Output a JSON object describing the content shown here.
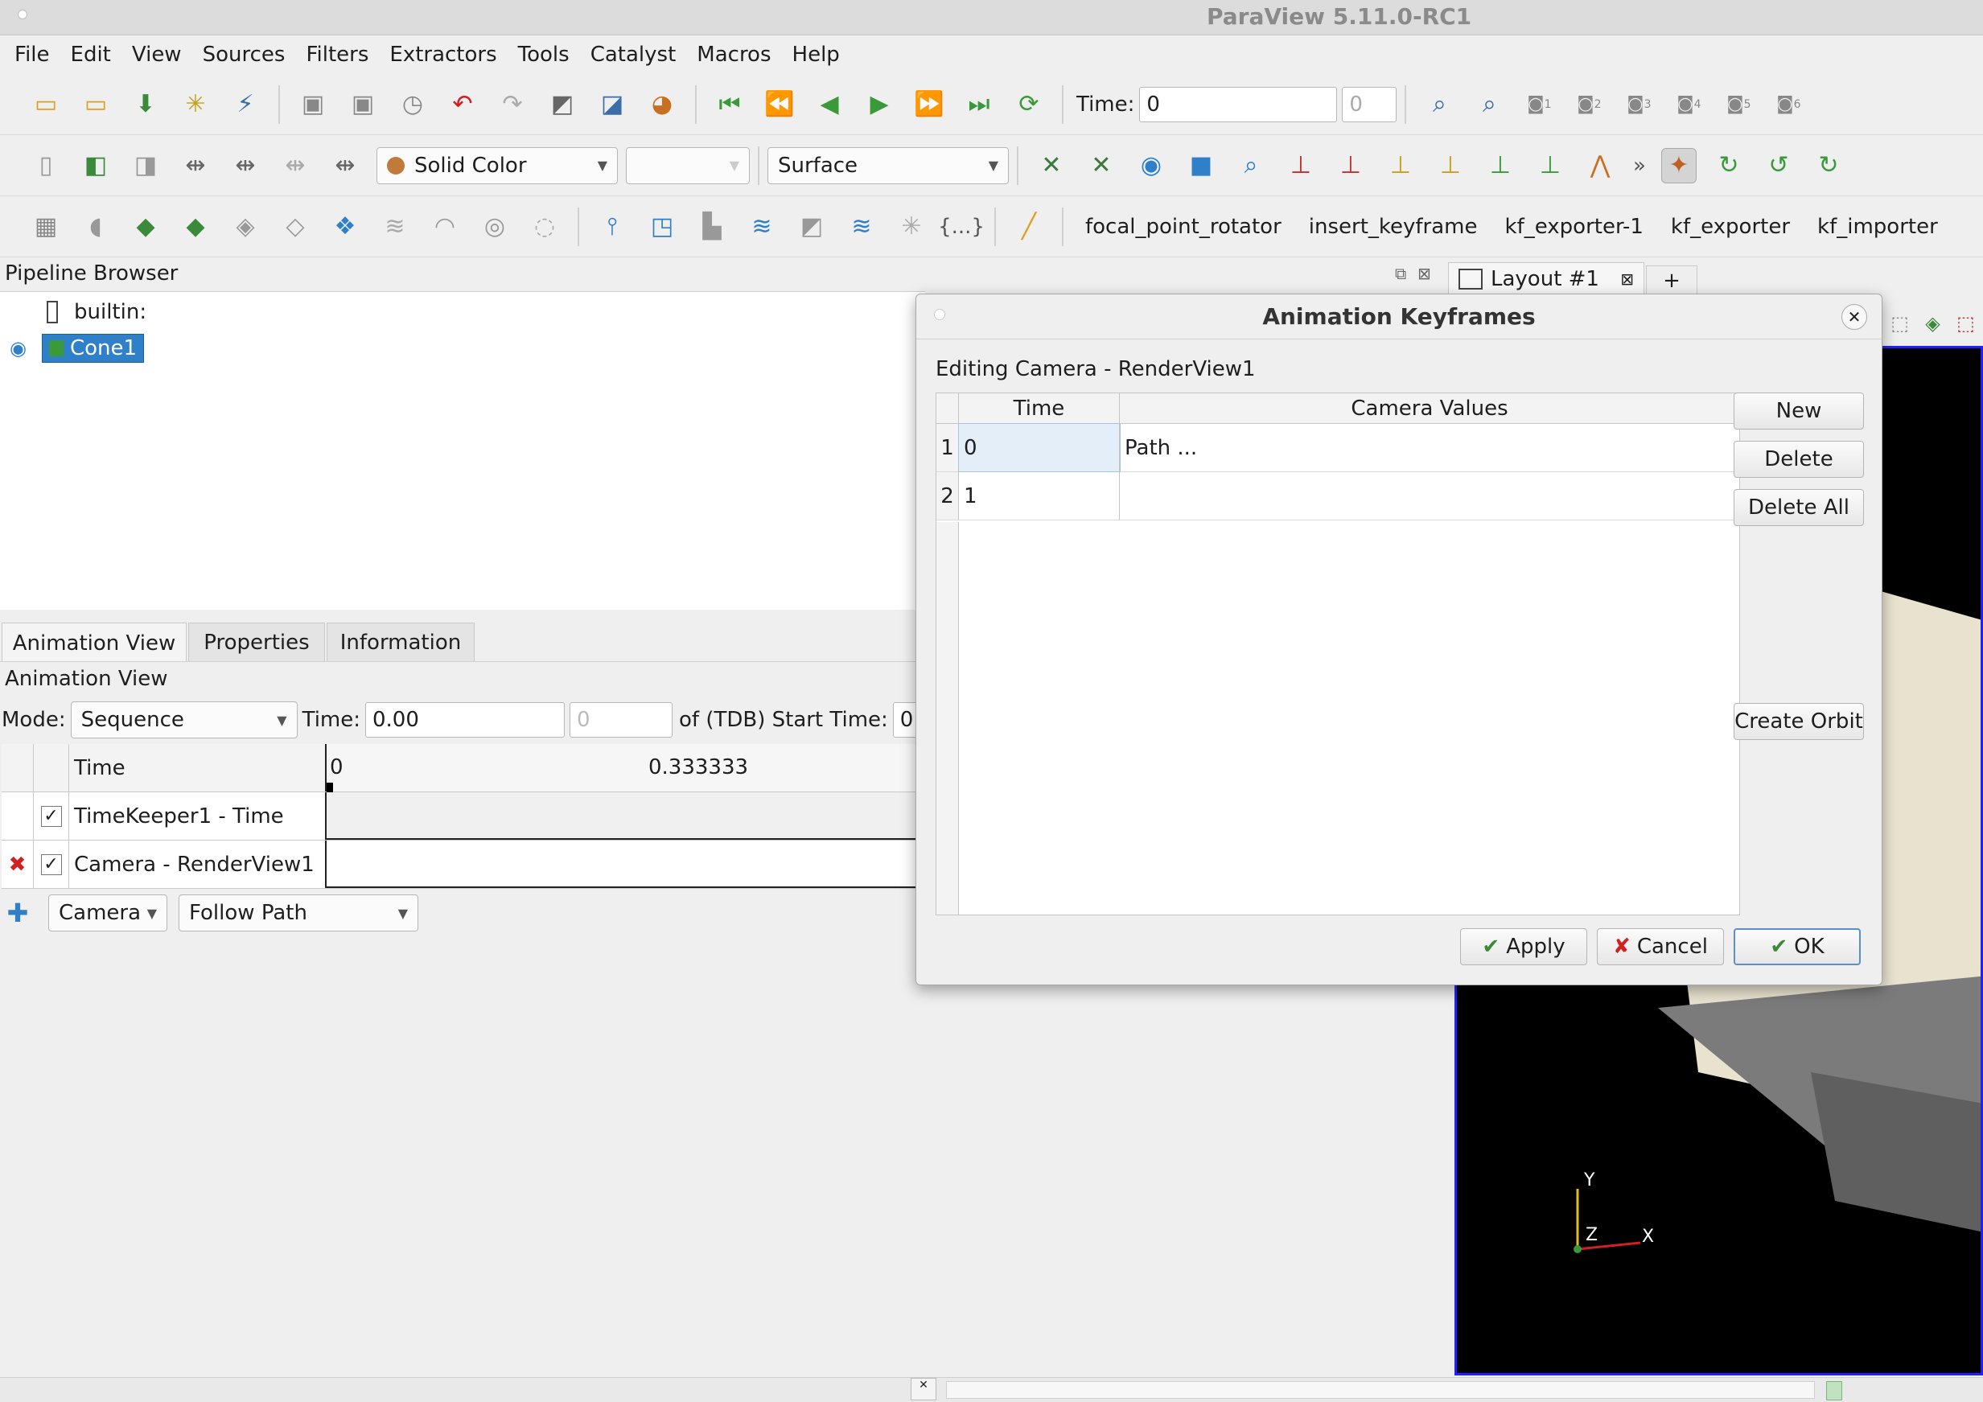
{
  "app": {
    "title": "ParaView 5.11.0-RC1"
  },
  "menu": [
    "File",
    "Edit",
    "View",
    "Sources",
    "Filters",
    "Extractors",
    "Tools",
    "Catalyst",
    "Macros",
    "Help"
  ],
  "toolbar1": {
    "time_label": "Time:",
    "time_value": "0",
    "time_index": "0",
    "camera_subscripts": [
      "1",
      "2",
      "3",
      "4",
      "5",
      "6"
    ]
  },
  "toolbar2": {
    "coloring": "Solid Color",
    "representation": "Surface",
    "more": "»"
  },
  "toolbar3": {
    "macros": [
      "focal_point_rotator",
      "insert_keyframe",
      "kf_exporter-1",
      "kf_exporter",
      "kf_importer"
    ],
    "braces": "{...}"
  },
  "pipeline": {
    "title": "Pipeline Browser",
    "builtin": "builtin:",
    "source": "Cone1"
  },
  "layout": {
    "tab": "Layout #1",
    "add": "+"
  },
  "tabs": [
    "Animation View",
    "Properties",
    "Information"
  ],
  "animation": {
    "title": "Animation View",
    "mode_label": "Mode:",
    "mode_value": "Sequence",
    "time_label": "Time:",
    "time_value": "0.00",
    "spin_value": "0",
    "of_label": "of (TDB) Start Time:",
    "start_value": "0",
    "header_time": "Time",
    "tick_start": "0",
    "tick_mid": "0.333333",
    "tracks": [
      {
        "label": "TimeKeeper1 - Time",
        "checked": "✓"
      },
      {
        "label": "Camera - RenderView1",
        "checked": "✓"
      }
    ],
    "add_source": "Camera",
    "add_mode": "Follow Path"
  },
  "dialog": {
    "title": "Animation Keyframes",
    "subtitle": "Editing Camera - RenderView1",
    "columns": [
      "Time",
      "Camera Values"
    ],
    "rows": [
      {
        "n": "1",
        "time": "0",
        "value": "Path ..."
      },
      {
        "n": "2",
        "time": "1",
        "value": ""
      }
    ],
    "buttons": {
      "new": "New",
      "delete": "Delete",
      "delete_all": "Delete All",
      "create_orbit": "Create Orbit"
    },
    "footer": {
      "apply": "Apply",
      "cancel": "Cancel",
      "ok": "OK"
    }
  },
  "axes": {
    "y": "Y",
    "z": "Z",
    "x": "X"
  },
  "colors": {
    "accent": "#2f7fc9",
    "render_border": "#2020ff",
    "render_bg": "#000000"
  }
}
